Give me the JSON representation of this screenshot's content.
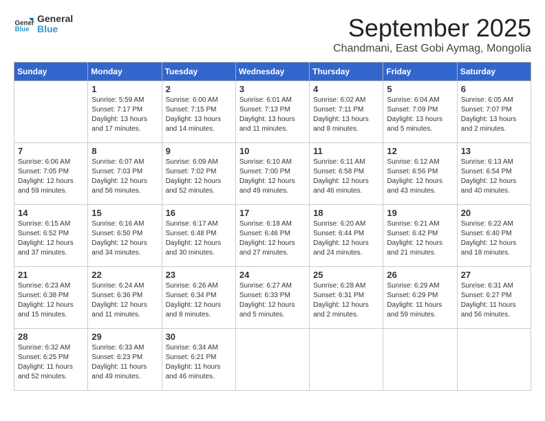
{
  "logo": {
    "text1": "General",
    "text2": "Blue"
  },
  "header": {
    "month": "September 2025",
    "location": "Chandmani, East Gobi Aymag, Mongolia"
  },
  "weekdays": [
    "Sunday",
    "Monday",
    "Tuesday",
    "Wednesday",
    "Thursday",
    "Friday",
    "Saturday"
  ],
  "weeks": [
    [
      {
        "day": "",
        "info": ""
      },
      {
        "day": "1",
        "info": "Sunrise: 5:59 AM\nSunset: 7:17 PM\nDaylight: 13 hours\nand 17 minutes."
      },
      {
        "day": "2",
        "info": "Sunrise: 6:00 AM\nSunset: 7:15 PM\nDaylight: 13 hours\nand 14 minutes."
      },
      {
        "day": "3",
        "info": "Sunrise: 6:01 AM\nSunset: 7:13 PM\nDaylight: 13 hours\nand 11 minutes."
      },
      {
        "day": "4",
        "info": "Sunrise: 6:02 AM\nSunset: 7:11 PM\nDaylight: 13 hours\nand 8 minutes."
      },
      {
        "day": "5",
        "info": "Sunrise: 6:04 AM\nSunset: 7:09 PM\nDaylight: 13 hours\nand 5 minutes."
      },
      {
        "day": "6",
        "info": "Sunrise: 6:05 AM\nSunset: 7:07 PM\nDaylight: 13 hours\nand 2 minutes."
      }
    ],
    [
      {
        "day": "7",
        "info": "Sunrise: 6:06 AM\nSunset: 7:05 PM\nDaylight: 12 hours\nand 59 minutes."
      },
      {
        "day": "8",
        "info": "Sunrise: 6:07 AM\nSunset: 7:03 PM\nDaylight: 12 hours\nand 56 minutes."
      },
      {
        "day": "9",
        "info": "Sunrise: 6:09 AM\nSunset: 7:02 PM\nDaylight: 12 hours\nand 52 minutes."
      },
      {
        "day": "10",
        "info": "Sunrise: 6:10 AM\nSunset: 7:00 PM\nDaylight: 12 hours\nand 49 minutes."
      },
      {
        "day": "11",
        "info": "Sunrise: 6:11 AM\nSunset: 6:58 PM\nDaylight: 12 hours\nand 46 minutes."
      },
      {
        "day": "12",
        "info": "Sunrise: 6:12 AM\nSunset: 6:56 PM\nDaylight: 12 hours\nand 43 minutes."
      },
      {
        "day": "13",
        "info": "Sunrise: 6:13 AM\nSunset: 6:54 PM\nDaylight: 12 hours\nand 40 minutes."
      }
    ],
    [
      {
        "day": "14",
        "info": "Sunrise: 6:15 AM\nSunset: 6:52 PM\nDaylight: 12 hours\nand 37 minutes."
      },
      {
        "day": "15",
        "info": "Sunrise: 6:16 AM\nSunset: 6:50 PM\nDaylight: 12 hours\nand 34 minutes."
      },
      {
        "day": "16",
        "info": "Sunrise: 6:17 AM\nSunset: 6:48 PM\nDaylight: 12 hours\nand 30 minutes."
      },
      {
        "day": "17",
        "info": "Sunrise: 6:18 AM\nSunset: 6:46 PM\nDaylight: 12 hours\nand 27 minutes."
      },
      {
        "day": "18",
        "info": "Sunrise: 6:20 AM\nSunset: 6:44 PM\nDaylight: 12 hours\nand 24 minutes."
      },
      {
        "day": "19",
        "info": "Sunrise: 6:21 AM\nSunset: 6:42 PM\nDaylight: 12 hours\nand 21 minutes."
      },
      {
        "day": "20",
        "info": "Sunrise: 6:22 AM\nSunset: 6:40 PM\nDaylight: 12 hours\nand 18 minutes."
      }
    ],
    [
      {
        "day": "21",
        "info": "Sunrise: 6:23 AM\nSunset: 6:38 PM\nDaylight: 12 hours\nand 15 minutes."
      },
      {
        "day": "22",
        "info": "Sunrise: 6:24 AM\nSunset: 6:36 PM\nDaylight: 12 hours\nand 11 minutes."
      },
      {
        "day": "23",
        "info": "Sunrise: 6:26 AM\nSunset: 6:34 PM\nDaylight: 12 hours\nand 8 minutes."
      },
      {
        "day": "24",
        "info": "Sunrise: 6:27 AM\nSunset: 6:33 PM\nDaylight: 12 hours\nand 5 minutes."
      },
      {
        "day": "25",
        "info": "Sunrise: 6:28 AM\nSunset: 6:31 PM\nDaylight: 12 hours\nand 2 minutes."
      },
      {
        "day": "26",
        "info": "Sunrise: 6:29 AM\nSunset: 6:29 PM\nDaylight: 11 hours\nand 59 minutes."
      },
      {
        "day": "27",
        "info": "Sunrise: 6:31 AM\nSunset: 6:27 PM\nDaylight: 11 hours\nand 56 minutes."
      }
    ],
    [
      {
        "day": "28",
        "info": "Sunrise: 6:32 AM\nSunset: 6:25 PM\nDaylight: 11 hours\nand 52 minutes."
      },
      {
        "day": "29",
        "info": "Sunrise: 6:33 AM\nSunset: 6:23 PM\nDaylight: 11 hours\nand 49 minutes."
      },
      {
        "day": "30",
        "info": "Sunrise: 6:34 AM\nSunset: 6:21 PM\nDaylight: 11 hours\nand 46 minutes."
      },
      {
        "day": "",
        "info": ""
      },
      {
        "day": "",
        "info": ""
      },
      {
        "day": "",
        "info": ""
      },
      {
        "day": "",
        "info": ""
      }
    ]
  ]
}
